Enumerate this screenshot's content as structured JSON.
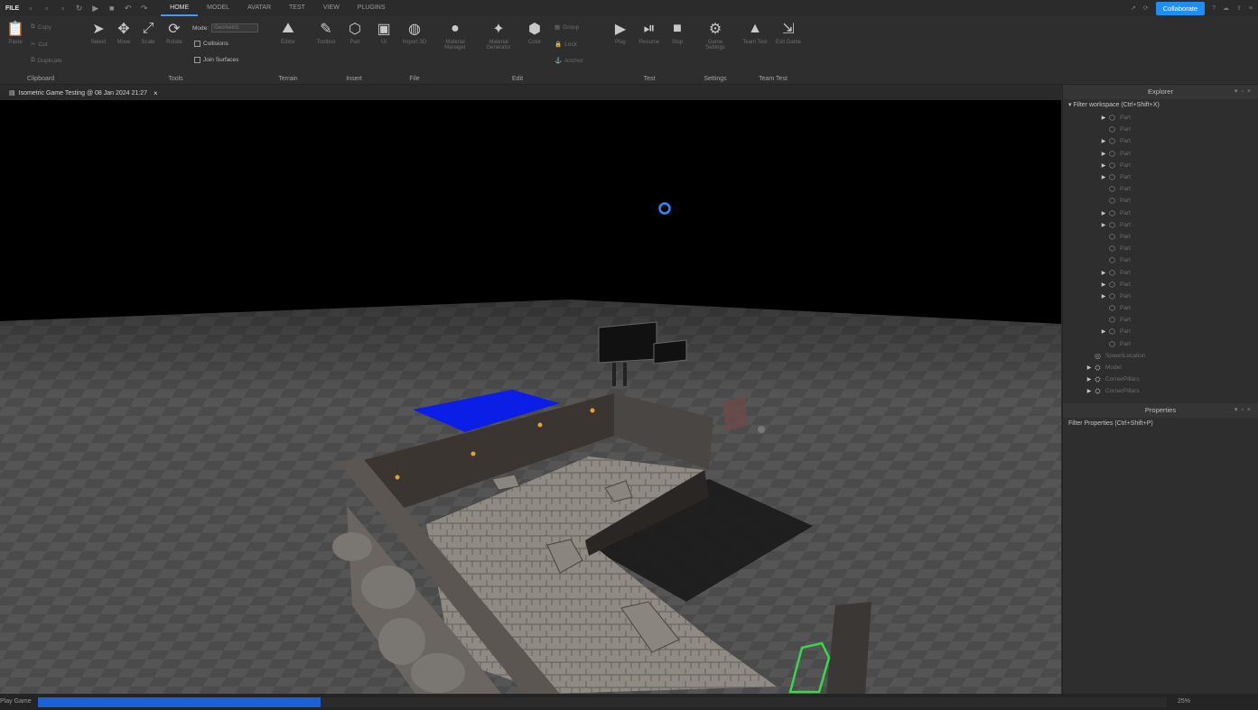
{
  "menu": {
    "file": "FILE",
    "tabs": [
      "HOME",
      "MODEL",
      "AVATAR",
      "TEST",
      "VIEW",
      "PLUGINS"
    ],
    "active_tab": "HOME",
    "collaborate": "Collaborate"
  },
  "ribbon": {
    "clipboard": {
      "label": "Clipboard",
      "paste": "Paste",
      "copy": "Copy",
      "cut": "Cut",
      "duplicate": "Duplicate"
    },
    "tools": {
      "label": "Tools",
      "select": "Select",
      "move": "Move",
      "scale": "Scale",
      "rotate": "Rotate",
      "mode_label": "Mode:",
      "mode_value": "Geometric",
      "collisions": "Collisions",
      "join_surfaces": "Join Surfaces"
    },
    "terrain": {
      "label": "Terrain",
      "editor": "Editor"
    },
    "insert": {
      "label": "Insert",
      "toolbox": "Toolbox",
      "part": "Part",
      "ui": "UI"
    },
    "file": {
      "label": "File",
      "import3d": "Import 3D"
    },
    "edit": {
      "label": "Edit",
      "material_manager": "Material Manager",
      "material_generator": "Material Generator",
      "color": "Color",
      "group": "Group",
      "lock": "Lock",
      "anchor": "Anchor"
    },
    "test": {
      "label": "Test",
      "play": "Play",
      "resume": "Resume",
      "stop": "Stop"
    },
    "settings": {
      "label": "Settings",
      "game_settings": "Game Settings"
    },
    "team_test": {
      "label": "Team Test",
      "team_test": "Team Test",
      "exit_game": "Exit Game"
    }
  },
  "document_tab": {
    "title": "Isometric Game Testing @ 08 Jan 2024 21:27"
  },
  "explorer": {
    "title": "Explorer",
    "filter": "Filter workspace (Ctrl+Shift+X)",
    "items": [
      {
        "label": "Part",
        "expand": true
      },
      {
        "label": "Part",
        "expand": false
      },
      {
        "label": "Part",
        "expand": true
      },
      {
        "label": "Part",
        "expand": true
      },
      {
        "label": "Part",
        "expand": true
      },
      {
        "label": "Part",
        "expand": true
      },
      {
        "label": "Part",
        "expand": false
      },
      {
        "label": "Part",
        "expand": false
      },
      {
        "label": "Part",
        "expand": true
      },
      {
        "label": "Part",
        "expand": true
      },
      {
        "label": "Part",
        "expand": false
      },
      {
        "label": "Part",
        "expand": false
      },
      {
        "label": "Part",
        "expand": false
      },
      {
        "label": "Part",
        "expand": true
      },
      {
        "label": "Part",
        "expand": true
      },
      {
        "label": "Part",
        "expand": true
      },
      {
        "label": "Part",
        "expand": false
      },
      {
        "label": "Part",
        "expand": false
      },
      {
        "label": "Part",
        "expand": true
      },
      {
        "label": "Part",
        "expand": false
      },
      {
        "label": "SpawnLocation",
        "expand": false
      },
      {
        "label": "Model",
        "expand": true
      },
      {
        "label": "CornerPillars",
        "expand": true
      },
      {
        "label": "CornerPillars",
        "expand": true
      }
    ]
  },
  "properties": {
    "title": "Properties",
    "filter": "Filter Properties (Ctrl+Shift+P)"
  },
  "status": {
    "label": "Play Game",
    "progress": 0.25,
    "percent": "25%"
  },
  "colors": {
    "accent": "#1d8ff2",
    "progress": "#1d62d4",
    "selection": "#39d84a",
    "water": "#0b1ee6"
  }
}
